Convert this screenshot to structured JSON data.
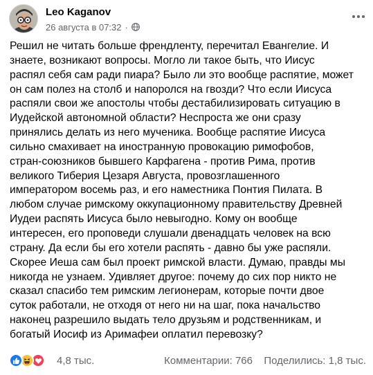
{
  "post": {
    "author": "Leo Kaganov",
    "date": "26 августа в 07:32",
    "separator": "·",
    "audience_icon": "globe-icon",
    "more_icon": "more-options-icon",
    "text_lines": [
      "Решил не читать больше френдленту, перечитал Евангелие. И",
      "знаете, возникают вопросы. Могло ли такое быть, что Иисус",
      "распял себя сам ради пиара? Было ли это вообще распятие, может",
      "он сам полез на столб и напоролся на гвозди? Что если Иисуса",
      "распяли свои же апостолы чтобы дестабилизировать ситуацию в",
      "Иудейской автономной области? Неспроста же они сразу",
      "принялись делать из него мученика. Вообще распятие Иисуса",
      "сильно смахивает на иностранную провокацию римофобов,",
      "стран-союзников бывшего Карфагена - против Рима, против",
      "великого Тиберия Цезаря Августа, провозглашенного",
      "императором восемь раз, и его наместника Понтия Пилата. В",
      "любом случае римскому оккупационному правительству Древней",
      "Иудеи распять Иисуса было невыгодно. Кому он вообще",
      "интересен, его проповеди слушали двенадцать человек на всю",
      "страну. Да если бы его хотели распять - давно бы уже распяли.",
      "Скорее Иеша сам был проект римской власти. Думаю, правды мы",
      "никогда не узнаем. Удивляет другое: почему до сих пор никто не",
      "сказал спасибо тем римским легионерам, которые почти двое",
      "суток работали, не отходя от него ни на шаг, пока начальство",
      "наконец разрешило выдать тело друзьям и родственникам, и",
      "богатый Иосиф из Аримафеи оплатил перевозку?"
    ]
  },
  "footer": {
    "reaction_icons": [
      "like-icon",
      "haha-icon",
      "love-icon"
    ],
    "reactions_count": "4,8 тыс.",
    "comments": "Комментарии: 766",
    "shares": "Поделились: 1,8 тыс."
  },
  "colors": {
    "text": "#050505",
    "secondary": "#65676b",
    "like": "#1877f2",
    "haha": "#f7c23a",
    "love": "#f33e58"
  }
}
